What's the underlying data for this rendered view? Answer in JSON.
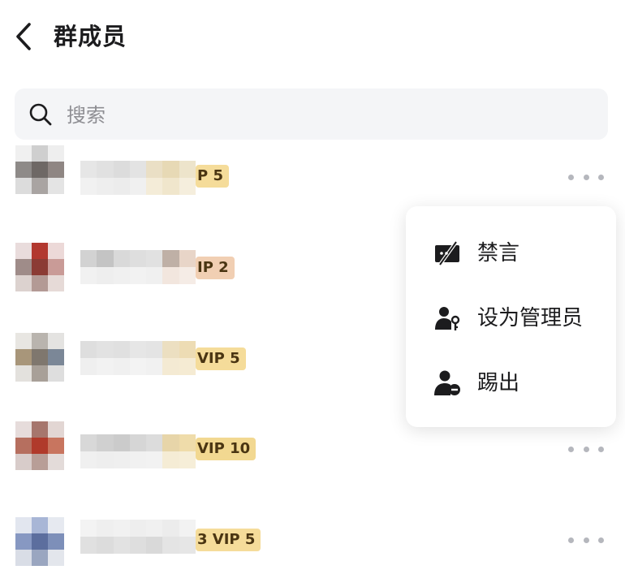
{
  "header": {
    "title": "群成员",
    "back_icon": "chevron-left-icon"
  },
  "search": {
    "placeholder": "搜索",
    "value": "",
    "icon": "search-icon"
  },
  "members": [
    {
      "badge": "P 5",
      "badge_color": "#f5dc9a",
      "has_more_button": true
    },
    {
      "badge": "IP 2",
      "badge_color": "#f1cfb3",
      "has_more_button": false
    },
    {
      "badge": "VIP 5",
      "badge_color": "#f5dc9a",
      "has_more_button": false
    },
    {
      "badge": "VIP 10",
      "badge_color": "#f2d891",
      "has_more_button": true
    },
    {
      "badge": "3 VIP 5",
      "badge_color": "#f5dc9a",
      "has_more_button": true
    }
  ],
  "context_menu": {
    "items": [
      {
        "label": "禁言",
        "icon": "mute-chat-icon"
      },
      {
        "label": "设为管理员",
        "icon": "user-key-icon"
      },
      {
        "label": "踢出",
        "icon": "user-remove-icon"
      }
    ]
  },
  "colors": {
    "text": "#1c1c1e",
    "placeholder": "#8e8e93",
    "search_bg": "#f4f5f7",
    "more_dots": "#b5b7bd"
  }
}
